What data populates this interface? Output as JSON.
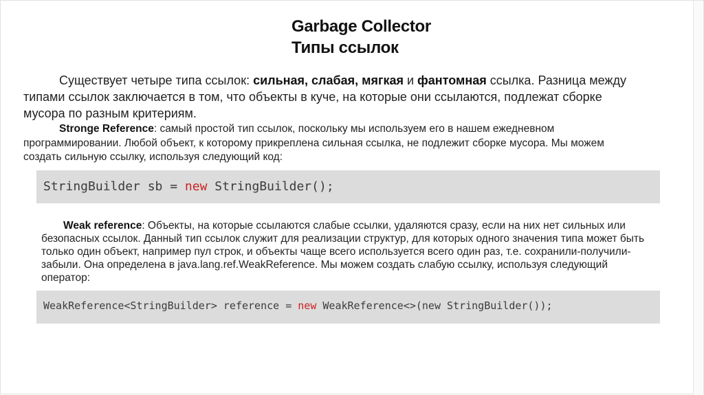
{
  "title": {
    "line1": "Garbage Collector",
    "line2": "Типы ссылок"
  },
  "intro": {
    "before": "Существует четыре типа ссылок: ",
    "types": "сильная, слабая, мягкая",
    "and": " и ",
    "phantom": "фантомная",
    "after": " ссылка. Разница между типами ссылок заключается в том, что объекты в куче, на которые они ссылаются, подлежат сборке мусора по разным критериям."
  },
  "strong": {
    "term": "Stronge Reference",
    "text": ": самый простой тип ссылок, поскольку мы используем его в нашем ежедневном программировании. Любой объект, к которому прикреплена сильная ссылка, не подлежит сборке мусора. Мы можем создать сильную ссылку, используя следующий код:",
    "code_before": "StringBuilder sb = ",
    "code_keyword": "new",
    "code_after": " StringBuilder();"
  },
  "weak": {
    "term": "Weak reference",
    "text": ": Объекты, на которые ссылаются слабые ссылки, удаляются сразу, если на них нет сильных или безопасных ссылок. Данный тип ссылок служит для реализации структур, для которых одного значения типа может быть только один объект, например пул строк, и объекты чаще всего используется всего один раз, т.е. сохранили-получили-забыли. Она определена в java.lang.ref.WeakReference. Мы можем создать слабую ссылку, используя следующий оператор:",
    "code_before": "WeakReference<StringBuilder> reference = ",
    "code_keyword": "new",
    "code_after": " WeakReference<>(new StringBuilder());"
  },
  "colors": {
    "code_background": "#dcdcdc",
    "keyword": "#cc2222"
  }
}
